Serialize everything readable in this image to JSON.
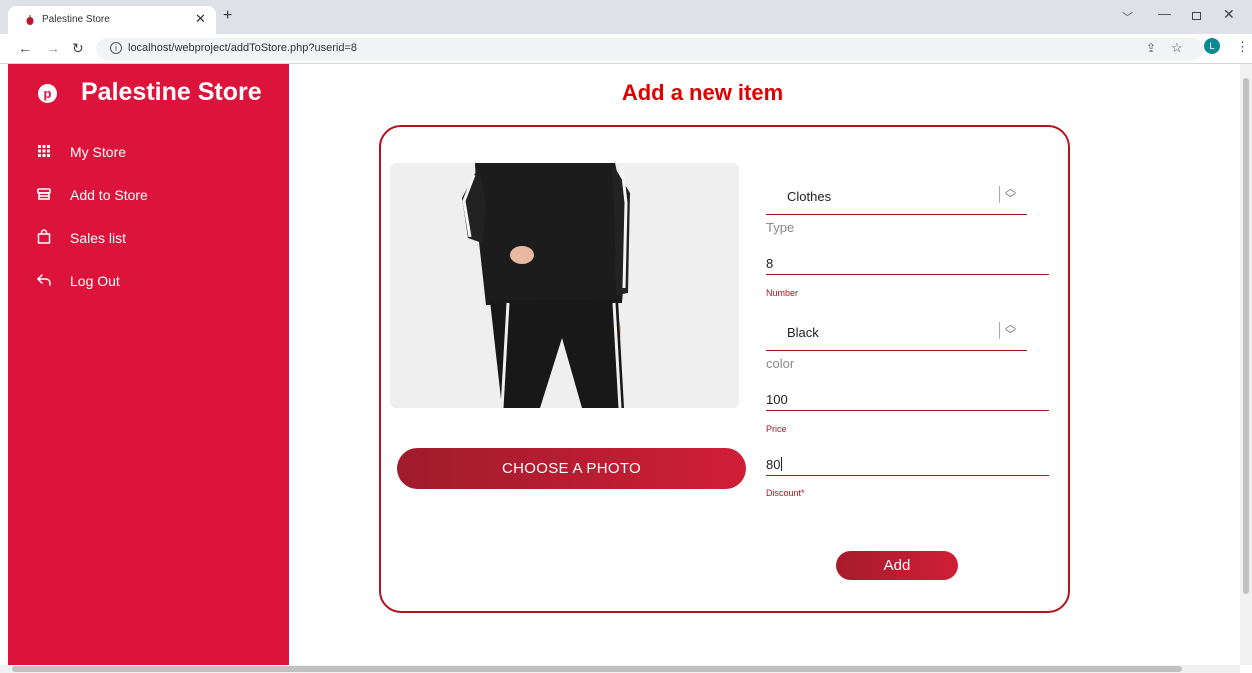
{
  "browser": {
    "tab_title": "Palestine Store",
    "url": "localhost/webproject/addToStore.php?userid=8",
    "profile_initial": "L"
  },
  "sidebar": {
    "brand": "Palestine Store",
    "items": [
      {
        "label": "My Store",
        "icon": "grid-icon"
      },
      {
        "label": "Add to Store",
        "icon": "store-icon"
      },
      {
        "label": "Sales list",
        "icon": "shopping-bag-icon"
      },
      {
        "label": "Log Out",
        "icon": "logout-arrow-icon"
      }
    ]
  },
  "main": {
    "title": "Add a new item",
    "choose_photo_label": "CHOOSE A PHOTO",
    "add_label": "Add",
    "form": {
      "type_value": "Clothes",
      "type_helper": "Type",
      "number_value": "8",
      "number_helper": "Number",
      "color_value": "Black",
      "color_helper": "color",
      "price_value": "100",
      "price_helper": "Price",
      "discount_value": "80",
      "discount_helper": "Discount*"
    }
  },
  "colors": {
    "sidebar_bg": "#dc143c",
    "accent": "#b3121f",
    "title": "#e00000"
  }
}
